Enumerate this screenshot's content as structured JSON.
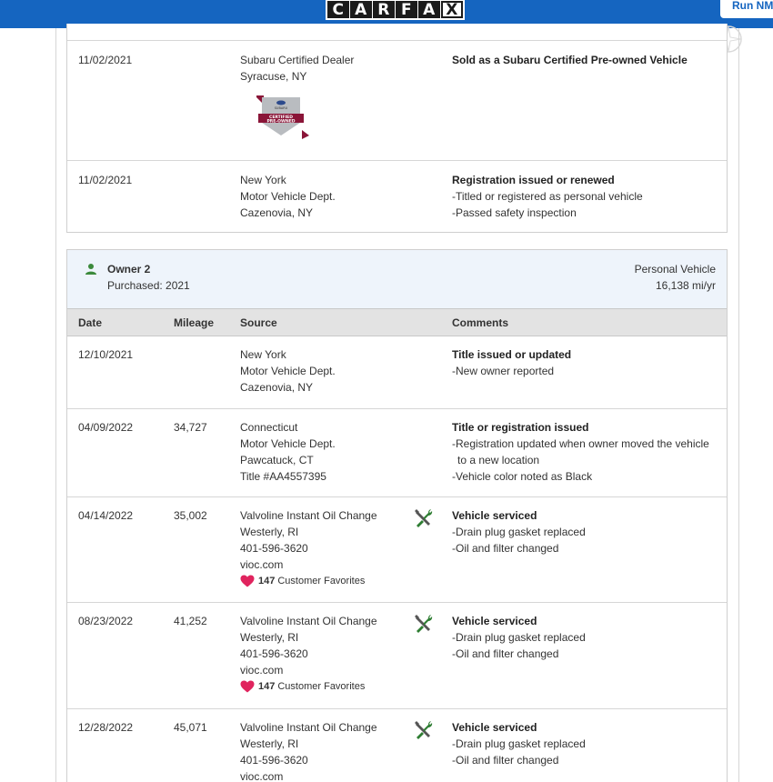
{
  "header": {
    "logo_letters": [
      "C",
      "A",
      "R",
      "F",
      "A",
      "X"
    ],
    "run_button": "Run NM"
  },
  "colors": {
    "header_blue": "#1565c0",
    "owner_bg": "#eef4fb",
    "heart": "#e0245e",
    "icon_gray": "#555555",
    "icon_green": "#2e7d32",
    "person_green": "#3c8a3c"
  },
  "owner1_records": [
    {
      "date": "11/02/2021",
      "mileage": "",
      "source": [
        "Subaru Certified Dealer",
        "Syracuse, NY"
      ],
      "badge": {
        "brand": "SUBARU",
        "line1": "CERTIFIED",
        "line2": "PRE-OWNED"
      },
      "comment_title": "Sold as a Subaru Certified Pre-owned Vehicle",
      "comments": []
    },
    {
      "date": "11/02/2021",
      "mileage": "",
      "source": [
        "New York",
        "Motor Vehicle Dept.",
        "Cazenovia, NY"
      ],
      "comment_title": "Registration issued or renewed",
      "comments": [
        "-Titled or registered as personal vehicle",
        "-Passed safety inspection"
      ]
    }
  ],
  "owner2": {
    "title": "Owner 2",
    "purchased": "Purchased: 2021",
    "type": "Personal Vehicle",
    "miles_per_year": "16,138 mi/yr"
  },
  "columns": {
    "date": "Date",
    "mileage": "Mileage",
    "source": "Source",
    "comments": "Comments"
  },
  "owner2_records": [
    {
      "date": "12/10/2021",
      "mileage": "",
      "source": [
        "New York",
        "Motor Vehicle Dept.",
        "Cazenovia, NY"
      ],
      "comment_title": "Title issued or updated",
      "comments": [
        "-New owner reported"
      ]
    },
    {
      "date": "04/09/2022",
      "mileage": "34,727",
      "source": [
        "Connecticut",
        "Motor Vehicle Dept.",
        "Pawcatuck, CT",
        "Title #AA4557395"
      ],
      "comment_title": "Title or registration issued",
      "comments": [
        "-Registration updated when owner moved the vehicle to a new location",
        "-Vehicle color noted as Black"
      ]
    },
    {
      "date": "04/14/2022",
      "mileage": "35,002",
      "source": [
        "Valvoline Instant Oil Change",
        "Westerly, RI",
        "401-596-3620",
        "vioc.com"
      ],
      "favorites_count": "147",
      "favorites_label": "Customer Favorites",
      "icon": "service-tools-icon",
      "comment_title": "Vehicle serviced",
      "comments": [
        "-Drain plug gasket replaced",
        "-Oil and filter changed"
      ]
    },
    {
      "date": "08/23/2022",
      "mileage": "41,252",
      "source": [
        "Valvoline Instant Oil Change",
        "Westerly, RI",
        "401-596-3620",
        "vioc.com"
      ],
      "favorites_count": "147",
      "favorites_label": "Customer Favorites",
      "icon": "service-tools-icon",
      "comment_title": "Vehicle serviced",
      "comments": [
        "-Drain plug gasket replaced",
        "-Oil and filter changed"
      ]
    },
    {
      "date": "12/28/2022",
      "mileage": "45,071",
      "source": [
        "Valvoline Instant Oil Change",
        "Westerly, RI",
        "401-596-3620",
        "vioc.com"
      ],
      "icon": "service-tools-icon",
      "comment_title": "Vehicle serviced",
      "comments": [
        "-Drain plug gasket replaced",
        "-Oil and filter changed"
      ]
    }
  ]
}
